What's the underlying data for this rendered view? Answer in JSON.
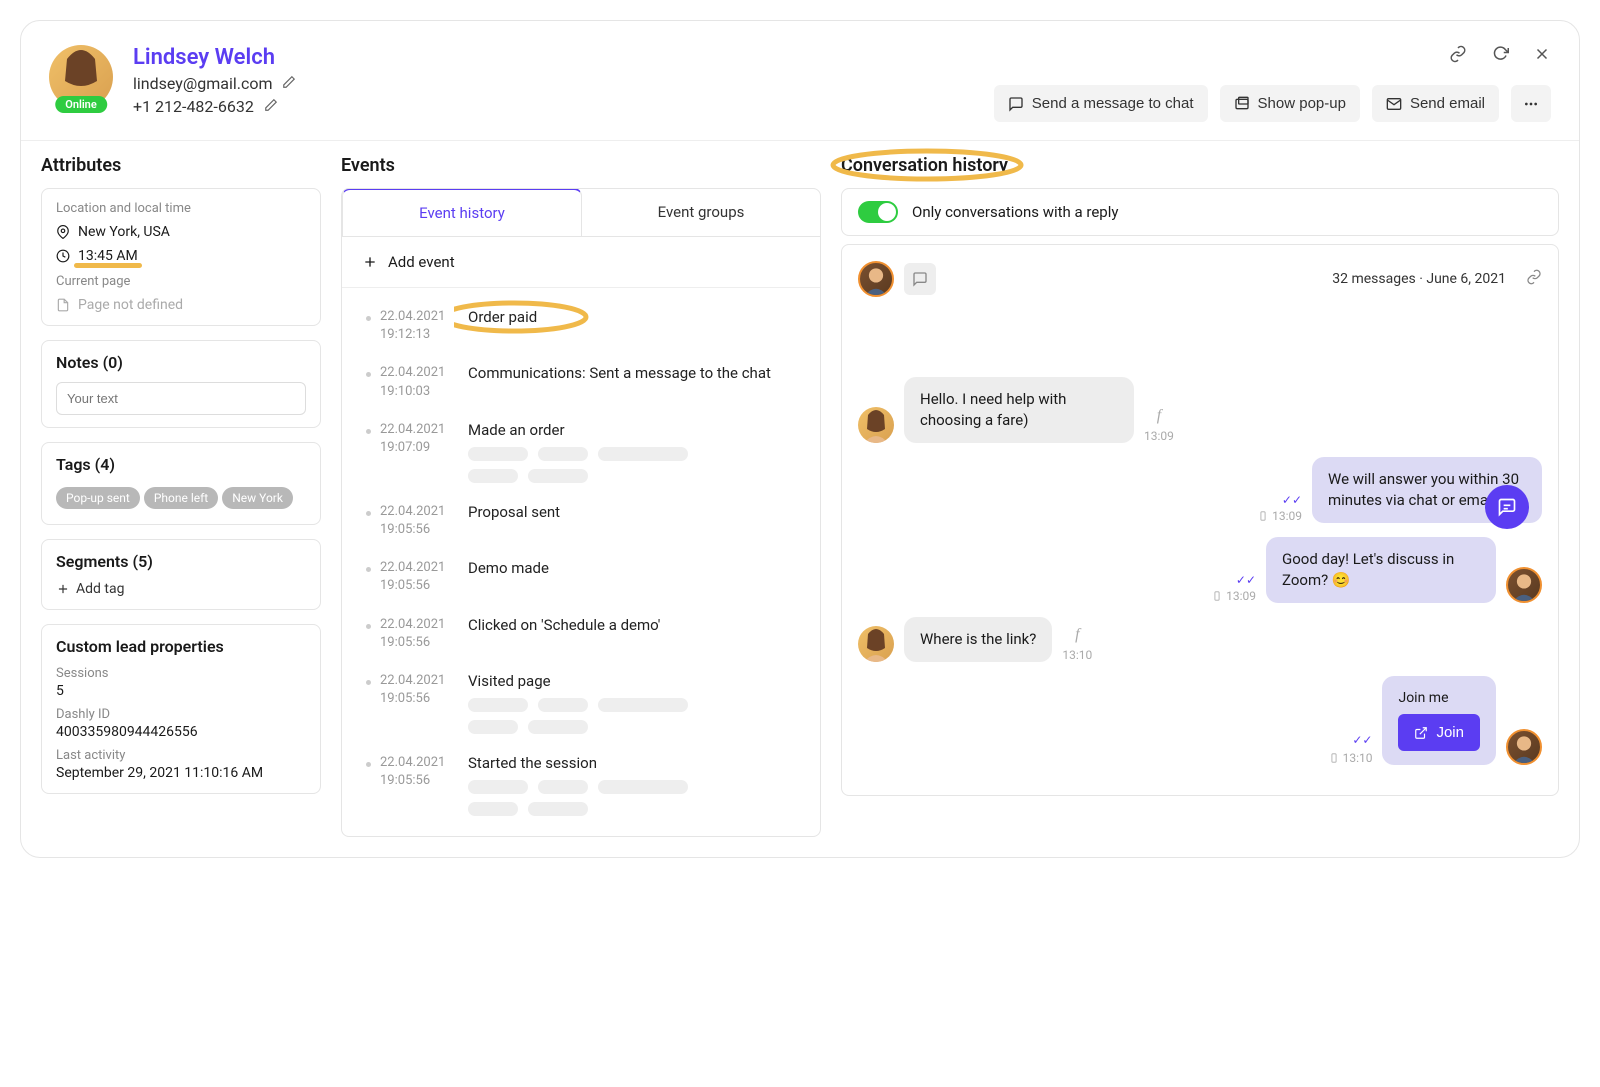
{
  "profile": {
    "name": "Lindsey Welch",
    "email": "lindsey@gmail.com",
    "phone": "+1 212-482-6632",
    "status": "Online"
  },
  "actions": {
    "send_chat": "Send a message to chat",
    "show_popup": "Show pop-up",
    "send_email": "Send email"
  },
  "attributes": {
    "heading": "Attributes",
    "location_label": "Location and local time",
    "location": "New York, USA",
    "time": "13:45 AM",
    "current_page_label": "Current page",
    "current_page": "Page not defined"
  },
  "notes": {
    "heading": "Notes (0)",
    "placeholder": "Your text"
  },
  "tags": {
    "heading": "Tags (4)",
    "items": [
      "Pop-up sent",
      "Phone left",
      "New York"
    ]
  },
  "segments": {
    "heading": "Segments (5)",
    "add_tag": "Add tag"
  },
  "custom_props": {
    "heading": "Custom lead properties",
    "sessions_label": "Sessions",
    "sessions_value": "5",
    "dashly_label": "Dashly ID",
    "dashly_value": "400335980944426556",
    "last_activity_label": "Last activity",
    "last_activity_value": "September 29, 2021 11:10:16 AM"
  },
  "events": {
    "heading": "Events",
    "tabs": {
      "history": "Event history",
      "groups": "Event groups"
    },
    "add_event": "Add event",
    "list": [
      {
        "date": "22.04.2021",
        "time": "19:12:13",
        "title": "Order paid",
        "highlight": true
      },
      {
        "date": "22.04.2021",
        "time": "19:10:03",
        "title": "Communications: Sent a message to the chat"
      },
      {
        "date": "22.04.2021",
        "time": "19:07:09",
        "title": "Made an order",
        "skeleton": true
      },
      {
        "date": "22.04.2021",
        "time": "19:05:56",
        "title": "Proposal sent"
      },
      {
        "date": "22.04.2021",
        "time": "19:05:56",
        "title": "Demo made"
      },
      {
        "date": "22.04.2021",
        "time": "19:05:56",
        "title": "Clicked on 'Schedule a demo'"
      },
      {
        "date": "22.04.2021",
        "time": "19:05:56",
        "title": "Visited page",
        "skeleton": true
      },
      {
        "date": "22.04.2021",
        "time": "19:05:56",
        "title": "Started the session",
        "skeleton": true
      }
    ]
  },
  "conversation": {
    "heading": "Conversation history",
    "filter_label": "Only conversations with a reply",
    "meta": "32 messages · June 6, 2021",
    "messages": [
      {
        "side": "other",
        "text": "Hello. I need help with choosing a fare)",
        "time": "13:09",
        "source": "f"
      },
      {
        "side": "mine",
        "text": "We will answer you within 30 minutes via chat or email.",
        "time": "13:09",
        "source": "mobile",
        "checks": true
      },
      {
        "side": "mine",
        "text": "Good day! Let's discuss in Zoom? 😊",
        "time": "13:09",
        "source": "mobile",
        "checks": true,
        "avatar": "male"
      },
      {
        "side": "other",
        "text": "Where is the link?",
        "time": "13:10",
        "source": "f"
      }
    ],
    "join": {
      "text": "Join me",
      "button": "Join",
      "time": "13:10"
    }
  }
}
